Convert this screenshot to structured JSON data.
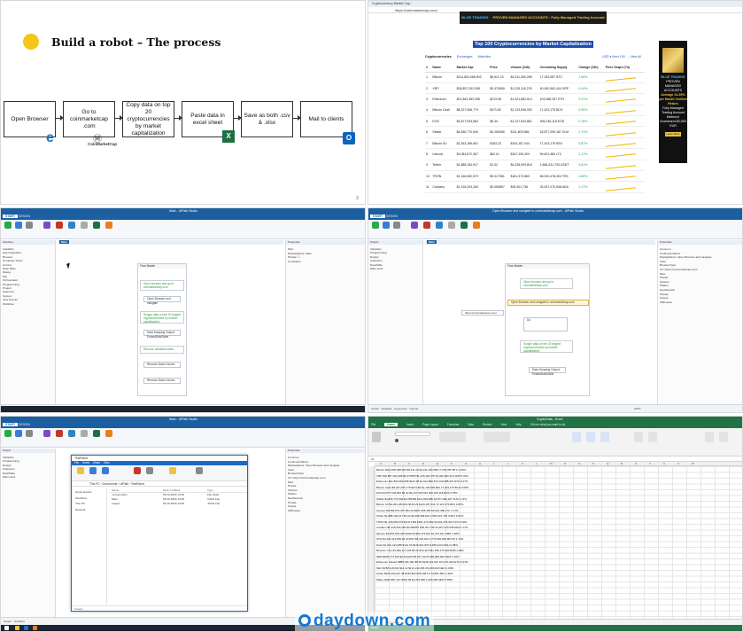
{
  "slide": {
    "title": "Build a robot – The process",
    "page_number": "3",
    "steps": [
      "Open Browser",
      "Go to coinmarketcap .com",
      "Copy data on top 20 cryptocurrencies by market capitalization",
      "Paste data in excel sheet",
      "Save as both .csv & .xlsx",
      "Mail to clients"
    ],
    "cmc_logo_text": "CoinMarketCap"
  },
  "browser": {
    "url": "https://coinmarketcap.com/",
    "tab": "Cryptocurrency Market Cap...",
    "ad_top_brand": "BLUE TRADING",
    "ad_top_text": "PROVEN MANAGED ACCOUNTS · Fully Managed Trading Account",
    "page_title": "Top 100 Cryptocurrencies by Market Capitalization",
    "tabs": [
      "Cryptocurrencies",
      "Exchanges",
      "Watchlist"
    ],
    "right_links": "USD ▾   Next 100 →   View All",
    "columns": [
      "#",
      "Name",
      "Market Cap",
      "Price",
      "Volume (24h)",
      "Circulating Supply",
      "Change (24h)",
      "Price Graph (7d)"
    ],
    "rows": [
      {
        "rank": "1",
        "name": "Bitcoin",
        "cap": "$114,800,068,903",
        "price": "$6,611.23",
        "vol": "$4,311,260,098",
        "supply": "17,333,087 BTC",
        "chg": "1.06%"
      },
      {
        "rank": "2",
        "name": "XRP",
        "cap": "$18,857,262,098",
        "price": "$0.470655",
        "vol": "$1,225,118,276",
        "supply": "40,062,962,444 XRP",
        "chg": "0.44%"
      },
      {
        "rank": "3",
        "name": "Ethereum",
        "cap": "$21,863,382,998",
        "price": "$213.98",
        "vol": "$1,921,882,513",
        "supply": "103,988,337 ETH",
        "chg": "0.47%"
      },
      {
        "rank": "4",
        "name": "Bitcoin Cash",
        "cap": "$8,227,066,779",
        "price": "$471.82",
        "vol": "$1,129,836,052",
        "supply": "17,423,175 BCH",
        "chg": "0.05%"
      },
      {
        "rank": "5",
        "name": "EOS",
        "cap": "$4,877,633,684",
        "price": "$5.40",
        "vol": "$1,247,534,861",
        "supply": "906,245,118 EOS",
        "chg": "0.78%"
      },
      {
        "rank": "6",
        "name": "Stellar",
        "cap": "$4,836,770,549",
        "price": "$0.255456",
        "vol": "$111,803,986",
        "supply": "18,877,099,187 XLM",
        "chg": "1.71%"
      },
      {
        "rank": "7",
        "name": "Bitcoin SV",
        "cap": "$3,263,186,661",
        "price": "$163.23",
        "vol": "$244,187,044",
        "supply": "17,423,175 BSV",
        "chg": "0.87%"
      },
      {
        "rank": "8",
        "name": "Litecoin",
        "cap": "$3,084,872,367",
        "price": "$52.01",
        "vol": "$347,295,309",
        "supply": "59,601,480 LTC",
        "chg": "1.17%"
      },
      {
        "rank": "9",
        "name": "Tether",
        "cap": "$1,888,184,917",
        "price": "$1.02",
        "vol": "$4,228,909,816",
        "supply": "1,866,431,793 USDT",
        "chg": "0.61%"
      },
      {
        "rank": "10",
        "name": "TRON",
        "cap": "$1,148,060,579",
        "price": "$0.017381",
        "vol": "$181,372,863",
        "supply": "66,002,478,304 TRX",
        "chg": "0.60%"
      },
      {
        "rank": "11",
        "name": "Cardano",
        "cap": "$1,318,203,260",
        "price": "$0.050857",
        "vol": "$39,301,736",
        "supply": "25,927,070,538 ADA",
        "chg": "1.17%"
      }
    ],
    "ad_side": {
      "brand": "BLUE TRADING",
      "headline": "PROVEN MANAGED ACCOUNTS",
      "line1": "Average 14.39% per Month Verified Return",
      "line2": "Fully Managed Trading Account",
      "min": "Minimum Investment $3,000 EUR",
      "cta": "Learn More"
    }
  },
  "studio1": {
    "title": "Main - UiPath Studio",
    "tabs": [
      "START",
      "DESIGN",
      "EXECUTE"
    ],
    "panel_left": "Activities",
    "tree": [
      "Available",
      "App Integration",
      "Browser",
      "Computer Vision",
      "Control",
      "Data Table",
      "Dialog",
      "File",
      "Orchestrator",
      "Programming",
      "Project",
      "Selectors",
      "System",
      "User Events",
      "Workflow"
    ],
    "canvas_tab": "Main",
    "sequence": "Flow Master",
    "comments": [
      "Open browser and go to coinmarketcap.com",
      "Scrape data on the 20 largest cryptocurrencies by market capitalization",
      "Remove unwanted data"
    ],
    "activities": [
      "Open Browser and navigate",
      "Data Scraping Output: ExtractDataTable",
      "Remove Data Column",
      "Remove Data Column"
    ],
    "hint": "Double-click to view",
    "props_title": "Properties",
    "props": [
      "Misc",
      "DisplayName: Main",
      "Private: ☐",
      "Annotation"
    ],
    "status_tabs": [
      "Output",
      "Variables",
      "Arguments",
      "Imports"
    ],
    "zoom": "100%"
  },
  "studio2": {
    "title": "Open Browser and navigate to coinmarketcap.com - UiPath Studio",
    "project": "Project",
    "tree": [
      "Variables",
      "Programming",
      "Design",
      "Collection",
      "DataTable",
      "Main.xaml"
    ],
    "sequence": "Flow Master",
    "highlight": "Open Browser and navigate to coinmarketcap.com",
    "tooltip": "https://coinmarketcap.com/",
    "inner": "Do",
    "comments": [
      "Open browser and go to coinmarketcap.com",
      "Scrape data on the 20 largest cryptocurrencies by market capitalization"
    ],
    "activity": "Data Scraping Output: ExtractDataTable",
    "props": [
      "Common",
      "ContinueOnError",
      "DisplayName: Open Browser and navigate",
      "Input",
      "BrowserType",
      "Url: https://coinmarketcap.com/",
      "Misc",
      "Private",
      "Options",
      "Hidden",
      "NewSession",
      "Private",
      "Output",
      "UiBrowser"
    ]
  },
  "explorer": {
    "title": "TestRobot",
    "tabs": [
      "File",
      "Home",
      "Share",
      "View"
    ],
    "address": "This PC › Documents › UiPath › TestRobot",
    "search": "Search TestRobot",
    "nav": [
      "Quick access",
      "OneDrive",
      "This PC",
      "Network"
    ],
    "columns": [
      "Name",
      "Date modified",
      "Type"
    ],
    "files": [
      {
        "name": ".screenshots",
        "date": "06.10.2018 13:06",
        "type": "File folder"
      },
      {
        "name": "Main",
        "date": "06.10.2018 13:06",
        "type": "XAML File"
      },
      {
        "name": "project",
        "date": "06.10.2018 13:06",
        "type": "JSON File"
      }
    ],
    "status": "3 items"
  },
  "excel": {
    "title": "CryptoData - Excel",
    "tabs": [
      "File",
      "Home",
      "Insert",
      "Page Layout",
      "Formulas",
      "Data",
      "Review",
      "View",
      "Help",
      "Tell me what you want to do"
    ],
    "active_tab": "Home",
    "formula_bar": "A1",
    "columns": [
      "A",
      "B",
      "C",
      "D",
      "E",
      "F",
      "G",
      "H",
      "I",
      "J",
      "K",
      "L",
      "M",
      "N",
      "O",
      "P",
      "Q",
      "R",
      "S",
      "T",
      "U",
      "V",
      "W"
    ],
    "rows": [
      "Bitcoin  $114,800,068,903  $6,611.23  $4,311,260,098  17,333,087 BTC  1.06%",
      "XRP  $18,857,262,098  $0.470655  $1,225,118,276  40,062,962,444 XRP  0.44%",
      "Ethereum  $21,863,382,998  $213.98  $1,921,882,513  103,988,337 ETH  0.47%",
      "Bitcoin Cash  $8,227,066,779  $471.82  $1,129,836,052  17,423,175 BCH  0.05%",
      "EOS  $4,877,633,684  $5.40  $1,247,534,861  906,245,118 EOS  0.78%",
      "Stellar  $4,836,770,549  $0.255456  $111,803,986  18,877,099,187 XLM  1.71%",
      "Bitcoin SV  $3,263,186,661  $163.23  $244,187,044  17,423,175 BSV  0.87%",
      "Litecoin  $3,084,872,367  $52.01  $347,295,309  59,601,480 LTC  1.17%",
      "Tether  $1,888,184,917  $1.02  $4,228,909,816  1,866,431,793 USDT  0.61%",
      "TRON  $1,148,060,579  $0.017381  $181,372,863  66,002,478,304 TRX  0.60%",
      "Cardano  $1,318,203,260  $0.050857  $39,301,736  25,927,070,538 ADA  1.17%",
      "Monero  $1,801,978,330  $109.63  $30,173,821  16,437,021 XMR  1.28%",
      "IOTA  $1,320,113,981  $0.474937  $8,233,001  2,779,530,283 MIOTA  1.72%",
      "Dash  $1,202,413,088  $141.69  $116,901,870  8,488,440 DASH  0.98%",
      "Binance Coin  $1,006,117,218  $5.26  $13,113,821  189,175,490 BNB  1.09%",
      "NEM  $939,773,618  $0.104419  $5,337,913  8,999,999,999 XEM  1.40%",
      "Ethereum Classic  $885,231,091  $8.56  $108,113,010  103,371,823 ETC  0.91%",
      "NEO  $788,118,034  $12.12  $131,210,081  65,000,000 NEO  1.09%",
      "Zcash  $620,193,227  $119.84  $64,008,198  5,173,881 ZEC  1.40%",
      "Maker  $491,887,127  $491.69  $1,231,860  1,000,000 MKR  0.88%"
    ],
    "sheet_tab": "CryptoData",
    "status": "Ready"
  },
  "watermark": "daydown.com"
}
